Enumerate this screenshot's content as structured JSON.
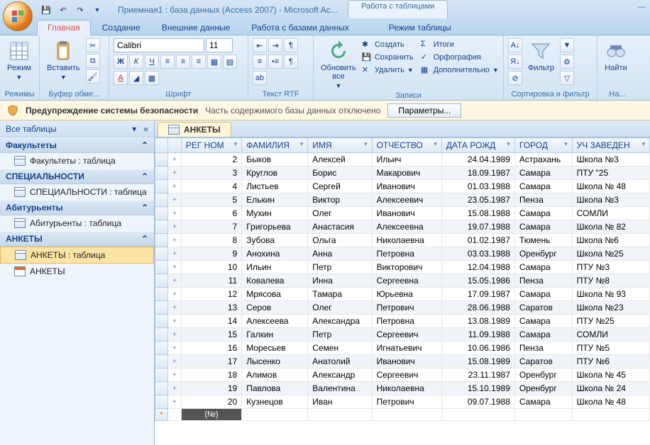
{
  "title": "Приемная1 : база данных (Access 2007) - Microsoft Ac...",
  "tools_tab_group": "Работа с таблицами",
  "tabs": {
    "home": "Главная",
    "create": "Создание",
    "external": "Внешние данные",
    "dbtools": "Работа с базами данных",
    "tablemode": "Режим таблицы"
  },
  "ribbon": {
    "modes": {
      "label": "Режимы",
      "view": "Режим"
    },
    "clipboard": {
      "label": "Буфер обме...",
      "paste": "Вставить"
    },
    "font": {
      "label": "Шрифт",
      "name": "Calibri",
      "size": "11"
    },
    "rtf": {
      "label": "Текст RTF"
    },
    "records": {
      "label": "Записи",
      "refresh": "Обновить\nвсе",
      "new": "Создать",
      "save": "Сохранить",
      "delete": "Удалить",
      "totals": "Итоги",
      "spelling": "Орфография",
      "more": "Дополнительно"
    },
    "sortfilter": {
      "label": "Сортировка и фильтр",
      "filter": "Фильтр"
    },
    "find": {
      "label": "На...",
      "btn": "Найти"
    }
  },
  "security": {
    "title": "Предупреждение системы безопасности",
    "msg": "Часть содержимого базы данных отключено",
    "btn": "Параметры..."
  },
  "nav": {
    "header": "Все таблицы",
    "groups": [
      {
        "name": "Факультеты",
        "items": [
          {
            "label": "Факультеты : таблица",
            "type": "table"
          }
        ]
      },
      {
        "name": "СПЕЦИАЛЬНОСТИ",
        "items": [
          {
            "label": "СПЕЦИАЛЬНОСТИ : таблица",
            "type": "table"
          }
        ]
      },
      {
        "name": "Абитурьенты",
        "items": [
          {
            "label": "Абитурьенты : таблица",
            "type": "table"
          }
        ]
      },
      {
        "name": "АНКЕТЫ",
        "items": [
          {
            "label": "АНКЕТЫ : таблица",
            "type": "table",
            "selected": true
          },
          {
            "label": "АНКЕТЫ",
            "type": "form"
          }
        ]
      }
    ]
  },
  "object_tab": "АНКЕТЫ",
  "columns": [
    "РЕГ НОМ",
    "ФАМИЛИЯ",
    "ИМЯ",
    "ОТЧЕСТВО",
    "ДАТА РОЖД",
    "ГОРОД",
    "УЧ ЗАВЕДЕН"
  ],
  "new_row_placeholder": "(№)",
  "rows": [
    {
      "n": 2,
      "f": "Быков",
      "i": "Алексей",
      "o": "Ильич",
      "d": "24.04.1989",
      "g": "Астрахань",
      "s": "Школа №3"
    },
    {
      "n": 3,
      "f": "Круглов",
      "i": "Борис",
      "o": "Макарович",
      "d": "18.09.1987",
      "g": "Самара",
      "s": "ПТУ \"25"
    },
    {
      "n": 4,
      "f": "Листьев",
      "i": "Сергей",
      "o": "Иванович",
      "d": "01.03.1988",
      "g": "Самара",
      "s": "Школа № 48"
    },
    {
      "n": 5,
      "f": "Елькин",
      "i": "Виктор",
      "o": "Алексеевич",
      "d": "23.05.1987",
      "g": "Пенза",
      "s": "Школа №3"
    },
    {
      "n": 6,
      "f": "Мухин",
      "i": "Олег",
      "o": "Иванович",
      "d": "15.08.1988",
      "g": "Самара",
      "s": "СОМЛИ"
    },
    {
      "n": 7,
      "f": "Григорьева",
      "i": "Анастасия",
      "o": "Алексеевна",
      "d": "19.07.1988",
      "g": "Самара",
      "s": "Школа № 82"
    },
    {
      "n": 8,
      "f": "Зубова",
      "i": "Ольга",
      "o": "Николаевна",
      "d": "01.02.1987",
      "g": "Тюмень",
      "s": "Школа №6"
    },
    {
      "n": 9,
      "f": "Анохина",
      "i": "Анна",
      "o": "Петровна",
      "d": "03.03.1988",
      "g": "Оренбург",
      "s": "Школа №25"
    },
    {
      "n": 10,
      "f": "Ильин",
      "i": "Петр",
      "o": "Викторович",
      "d": "12.04.1988",
      "g": "Самара",
      "s": "ПТУ №3"
    },
    {
      "n": 11,
      "f": "Ковалева",
      "i": "Инна",
      "o": "Сергеевна",
      "d": "15.05.1986",
      "g": "Пенза",
      "s": "ПТУ №8"
    },
    {
      "n": 12,
      "f": "Мрясова",
      "i": "Тамара",
      "o": "Юрьевна",
      "d": "17.09.1987",
      "g": "Самара",
      "s": "Школа № 93"
    },
    {
      "n": 13,
      "f": "Серов",
      "i": "Олег",
      "o": "Петрович",
      "d": "28.06.1988",
      "g": "Саратов",
      "s": "Школа №23"
    },
    {
      "n": 14,
      "f": "Алексеева",
      "i": "Александра",
      "o": "Петровна",
      "d": "13.08.1989",
      "g": "Самара",
      "s": "ПТУ №25"
    },
    {
      "n": 15,
      "f": "Галкин",
      "i": "Петр",
      "o": "Сергеевич",
      "d": "11.09.1988",
      "g": "Самара",
      "s": "СОМЛИ"
    },
    {
      "n": 16,
      "f": "Моресьев",
      "i": "Семен",
      "o": "Игнатьевич",
      "d": "10.06.1986",
      "g": "Пенза",
      "s": "ПТУ №5"
    },
    {
      "n": 17,
      "f": "Лысенко",
      "i": "Анатолий",
      "o": "Иванович",
      "d": "15.08.1989",
      "g": "Саратов",
      "s": "ПТУ №6"
    },
    {
      "n": 18,
      "f": "Алимов",
      "i": "Александр",
      "o": "Сергеевич",
      "d": "23.11.1987",
      "g": "Оренбург",
      "s": "Школа № 45"
    },
    {
      "n": 19,
      "f": "Павлова",
      "i": "Валентина",
      "o": "Николаевна",
      "d": "15.10.1989",
      "g": "Оренбург",
      "s": "Школа № 24"
    },
    {
      "n": 20,
      "f": "Кузнецов",
      "i": "Иван",
      "o": "Петрович",
      "d": "09.07.1988",
      "g": "Самара",
      "s": "Школа № 48"
    }
  ]
}
